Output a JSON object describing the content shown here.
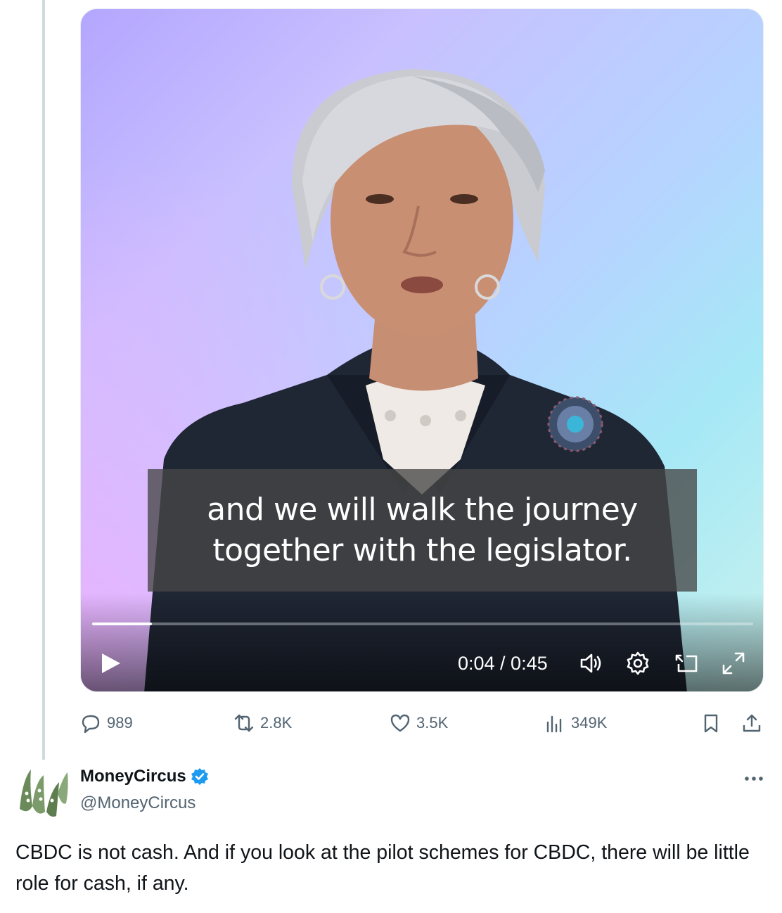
{
  "video": {
    "caption_line1": "and we will walk the journey",
    "caption_line2": "together with the legislator.",
    "time": "0:04 / 0:45",
    "progress": 0.09,
    "icons": {
      "play": "play-icon",
      "volume": "volume-icon",
      "settings": "settings-gear-icon",
      "pip": "picture-in-picture-icon",
      "fullscreen": "fullscreen-icon"
    }
  },
  "actions": {
    "replies": "989",
    "reposts": "2.8K",
    "likes": "3.5K",
    "views": "349K"
  },
  "author": {
    "name": "MoneyCircus",
    "handle": "@MoneyCircus",
    "verified": true
  },
  "tweet": {
    "text": "CBDC is not cash. And if you look at the pilot schemes for CBDC, there will be little role for cash, if any."
  },
  "colors": {
    "text_primary": "#0f1419",
    "text_secondary": "#536471",
    "verified_blue": "#1d9bf0",
    "thread_line": "#cfd9de"
  }
}
